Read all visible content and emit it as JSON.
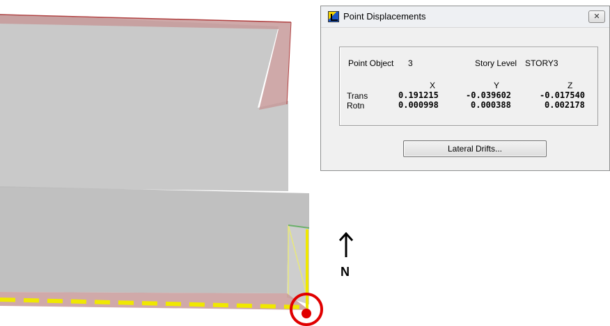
{
  "dialog": {
    "title": "Point Displacements",
    "close_glyph": "✕",
    "point_object_label": "Point Object",
    "point_object_value": "3",
    "story_level_label": "Story Level",
    "story_level_value": "STORY3",
    "column_headers": [
      "X",
      "Y",
      "Z"
    ],
    "rows": [
      {
        "label": "Trans",
        "values": [
          "0.191215",
          "-0.039602",
          "-0.017540"
        ]
      },
      {
        "label": "Rotn",
        "values": [
          "0.000998",
          "0.000388",
          "0.002178"
        ]
      }
    ],
    "lateral_drifts_button": "Lateral Drifts..."
  },
  "compass": {
    "arrow_icon": "up-arrow-icon",
    "label": "N"
  },
  "colors": {
    "model_fill": "#c8c8c8",
    "frame_red": "#c05050",
    "selection_yellow": "#f0e800",
    "marker_red": "#e00000"
  }
}
